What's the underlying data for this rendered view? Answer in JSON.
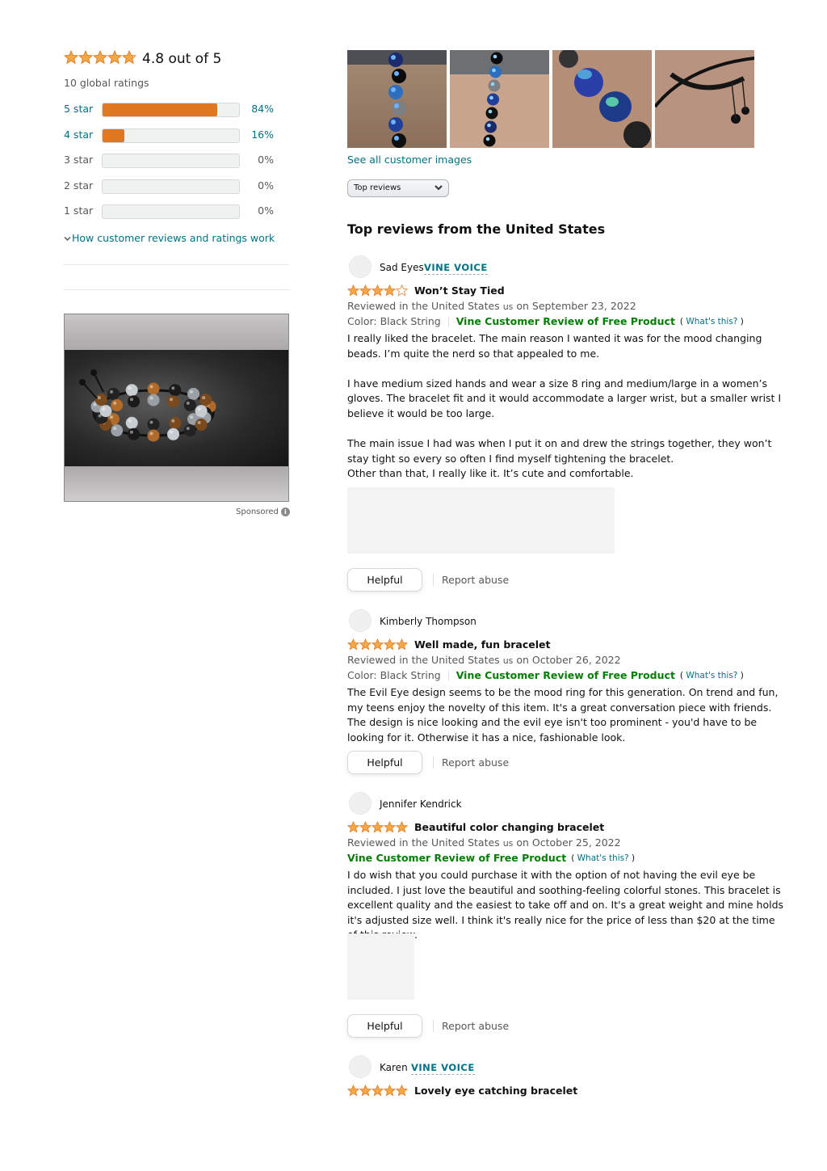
{
  "summary": {
    "rating_text": "4.8 out of 5",
    "stars": 4.8,
    "global_ratings": "10 global ratings",
    "histogram": [
      {
        "label": "5 star",
        "pct": "84%",
        "value": 0.84,
        "linked": true
      },
      {
        "label": "4 star",
        "pct": "16%",
        "value": 0.16,
        "linked": true
      },
      {
        "label": "3 star",
        "pct": "0%",
        "value": 0,
        "linked": false
      },
      {
        "label": "2 star",
        "pct": "0%",
        "value": 0,
        "linked": false
      },
      {
        "label": "1 star",
        "pct": "0%",
        "value": 0,
        "linked": false
      }
    ],
    "how_link": "How customer reviews and ratings work"
  },
  "ad": {
    "sponsored_label": "Sponsored"
  },
  "images": {
    "see_all": "See all customer images"
  },
  "sort": {
    "selected": "Top reviews"
  },
  "reviews_title": "Top reviews from the United States",
  "reviews": [
    {
      "author": "Sad Eyes",
      "badge": "VINE VOICE",
      "stars": 4,
      "title": "Won’t Stay Tied",
      "meta_pre": "Reviewed in the United States",
      "meta_us": "us",
      "meta_post": "on September 23, 2022",
      "color": "Color: Black String",
      "vine_label": "Vine Customer Review of Free Product",
      "whats_this": "What's this?",
      "body": [
        "I really liked the bracelet. The main reason I wanted it was for the mood changing beads. I’m quite the nerd so that appealed to me.",
        "I have medium sized hands and wear a size 8 ring and medium/large in a women’s gloves. The bracelet fit and it would accommodate a larger wrist, but a smaller wrist I believe it would be too large.",
        "The main issue I had was when I put it on and drew the strings together, they won’t stay tight so every so often I find myself tightening the bracelet.\nOther than that, I really like it. It’s cute and comfortable."
      ],
      "helpful": "Helpful",
      "report": "Report abuse"
    },
    {
      "author": "Kimberly Thompson",
      "badge": "",
      "stars": 5,
      "title": "Well made, fun bracelet",
      "meta_pre": "Reviewed in the United States",
      "meta_us": "us",
      "meta_post": "on October 26, 2022",
      "color": "Color: Black String",
      "vine_label": "Vine Customer Review of Free Product",
      "whats_this": "What's this?",
      "body": [
        "The Evil Eye design seems to be the mood ring for this generation. On trend and fun, my teens enjoy the novelty of this item. It's a great conversation piece with friends. The design is nice looking and the evil eye isn't too prominent - you'd have to be looking for it. Otherwise it has a nice, fashionable look."
      ],
      "helpful": "Helpful",
      "report": "Report abuse"
    },
    {
      "author": "Jennifer Kendrick",
      "badge": "",
      "stars": 5,
      "title": "Beautiful color changing bracelet",
      "meta_pre": "Reviewed in the United States",
      "meta_us": "us",
      "meta_post": "on October 25, 2022",
      "color": "",
      "vine_label": "Vine Customer Review of Free Product",
      "whats_this": "What's this?",
      "body": [
        "I do wish that you could purchase it with the option of not having the evil eye be included. I just love the beautiful and soothing-feeling colorful stones. This bracelet is excellent quality and the easiest to take off and on. It's a great weight and mine holds it's adjusted size well. I think it's really nice for the price of less than $20 at the time of this review."
      ],
      "helpful": "Helpful",
      "report": "Report abuse"
    },
    {
      "author": "Karen",
      "badge": "VINE VOICE",
      "stars": 5,
      "title": "Lovely eye catching bracelet"
    }
  ],
  "colors": {
    "star": "#f3a847",
    "link": "#007185",
    "vine_green": "#067d06"
  }
}
